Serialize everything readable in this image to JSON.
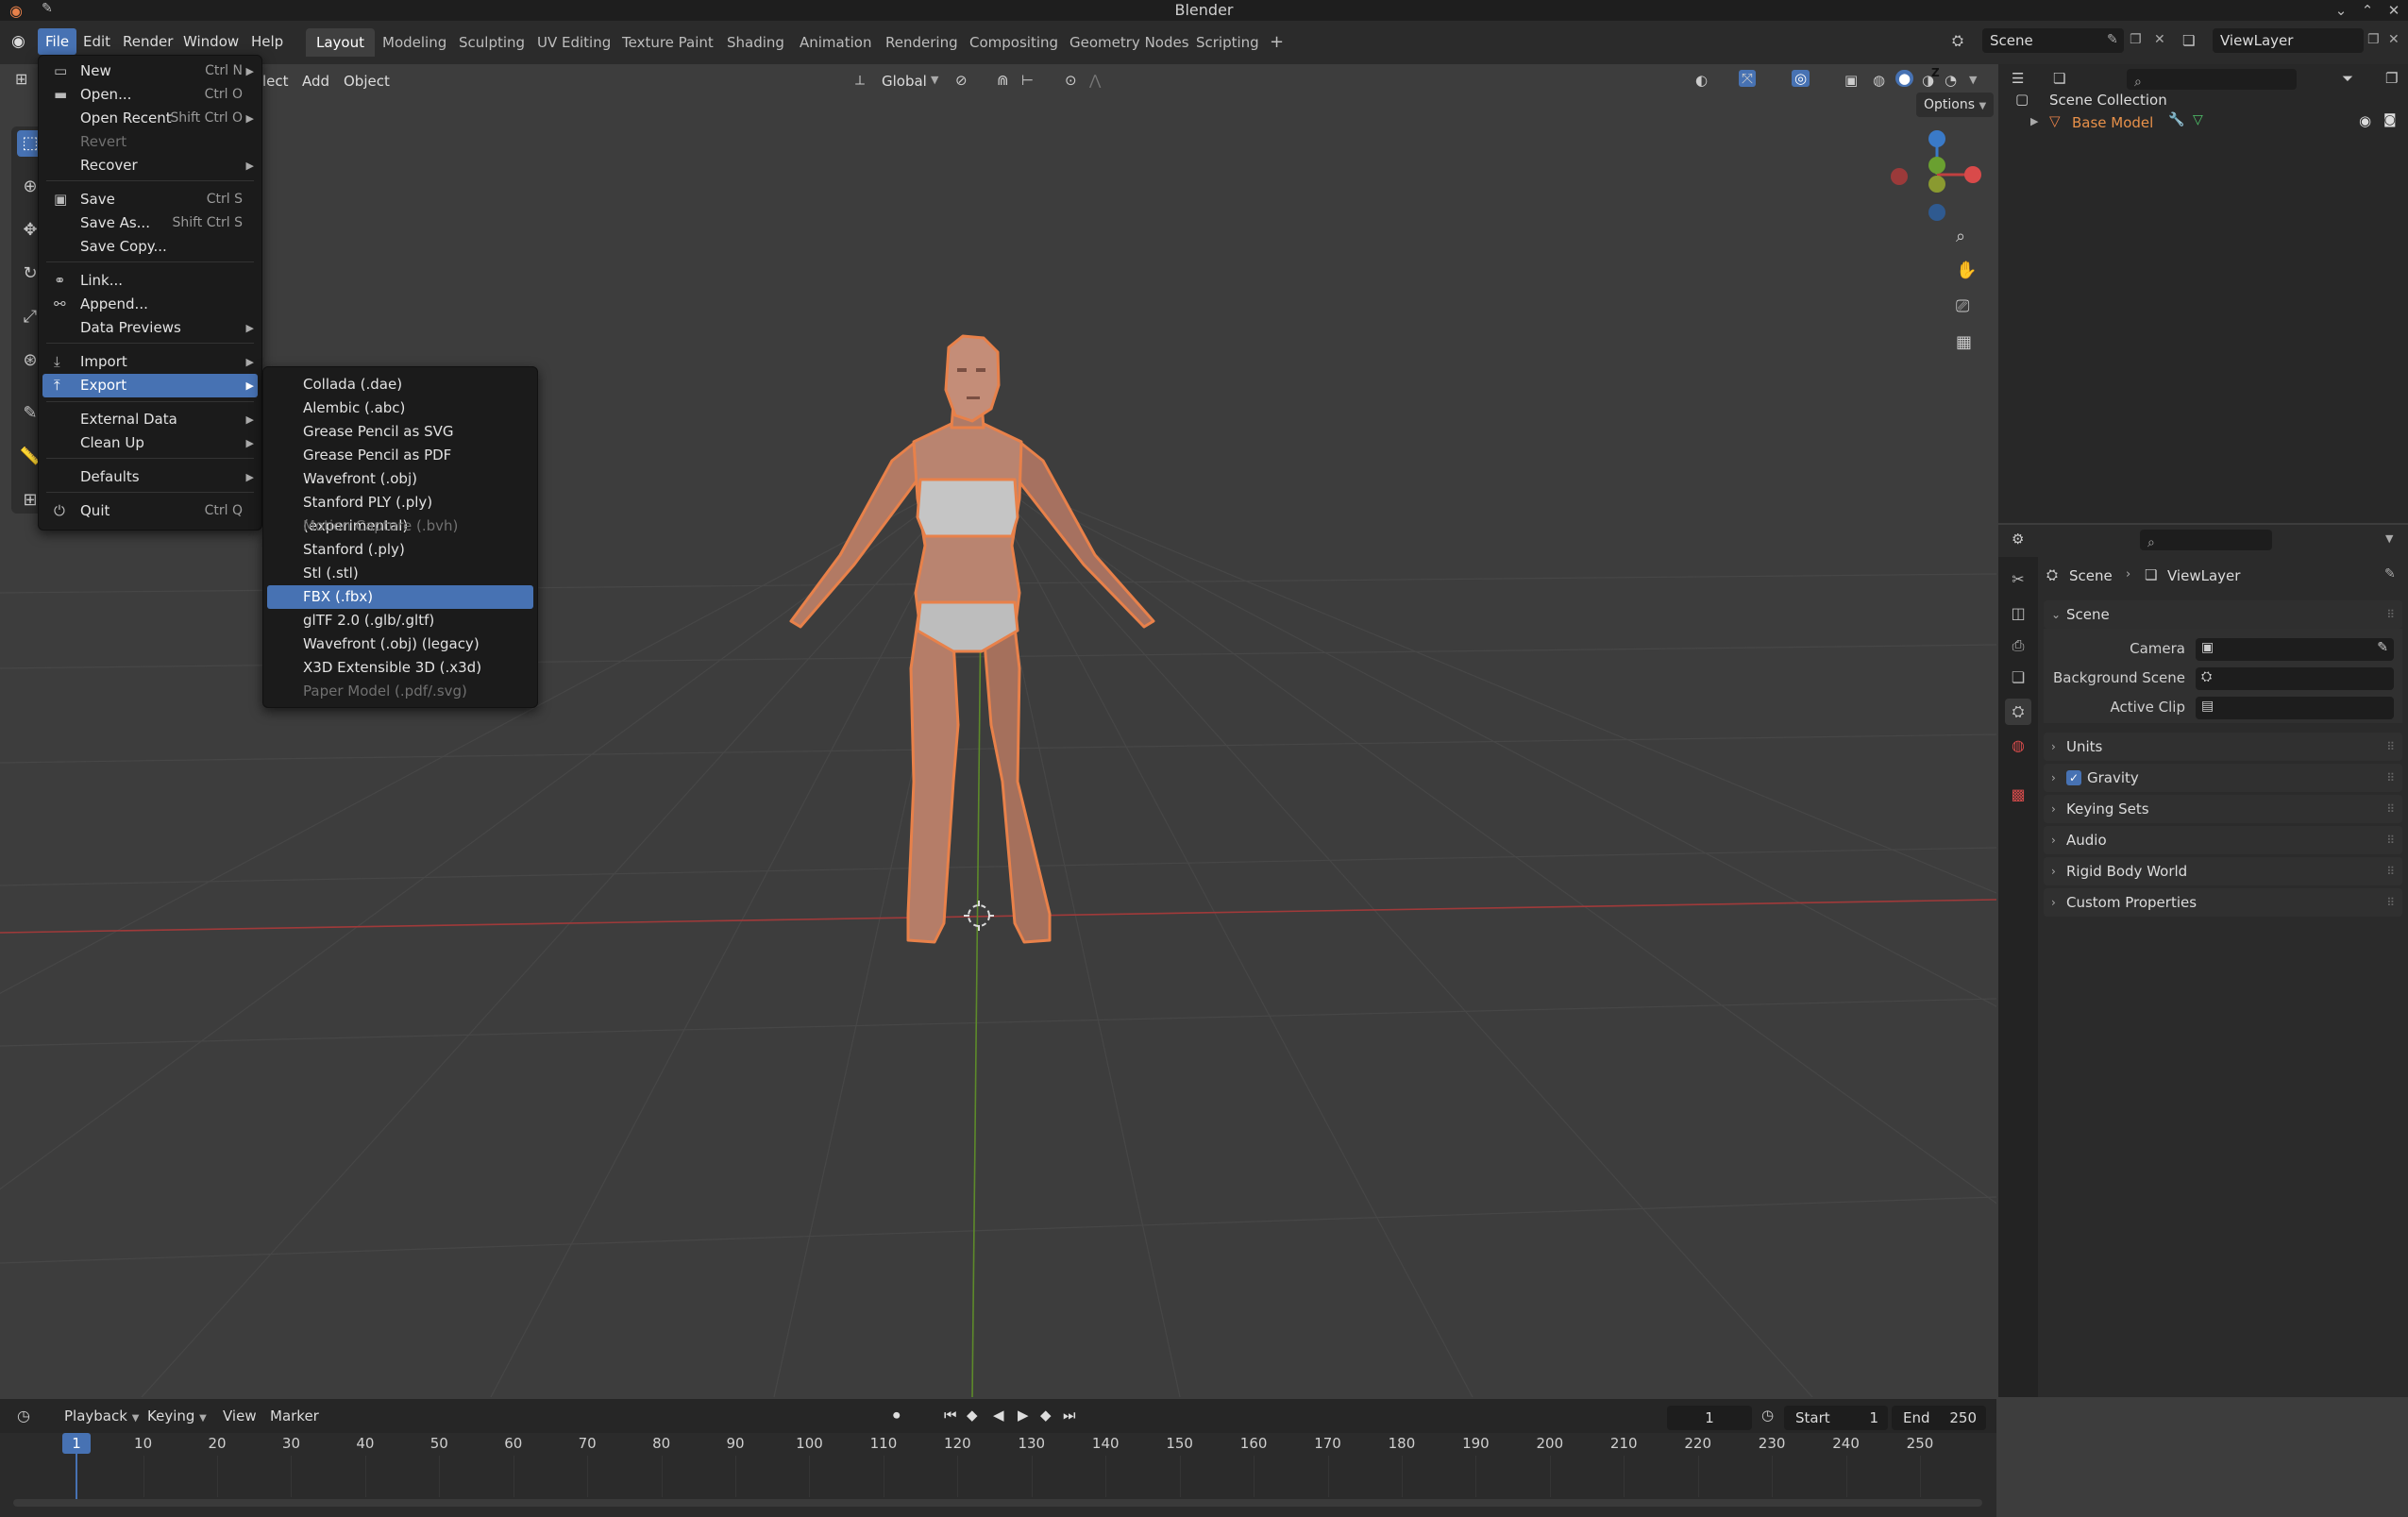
{
  "window": {
    "title": "Blender"
  },
  "menubar": {
    "items": [
      "File",
      "Edit",
      "Render",
      "Window",
      "Help"
    ],
    "active": "File"
  },
  "workspaces": {
    "tabs": [
      "Layout",
      "Modeling",
      "Sculpting",
      "UV Editing",
      "Texture Paint",
      "Shading",
      "Animation",
      "Rendering",
      "Compositing",
      "Geometry Nodes",
      "Scripting"
    ],
    "active": "Layout",
    "add": "+"
  },
  "scene_selector": {
    "value": "Scene"
  },
  "viewlayer_selector": {
    "value": "ViewLayer"
  },
  "viewport_header": {
    "select_partial": "lect",
    "add": "Add",
    "object": "Object",
    "transform_orientation": "Global",
    "options": "Options"
  },
  "gizmo": {
    "z": "Z",
    "y": "Y",
    "x": "X"
  },
  "file_menu": {
    "items": [
      {
        "label": "New",
        "shortcut": "Ctrl N",
        "icon": "new-file-icon",
        "submenu": true
      },
      {
        "label": "Open...",
        "shortcut": "Ctrl O",
        "icon": "folder-icon"
      },
      {
        "label": "Open Recent",
        "shortcut": "Shift Ctrl O",
        "submenu": true
      },
      {
        "label": "Revert",
        "disabled": true
      },
      {
        "label": "Recover",
        "submenu": true
      },
      {
        "label": "Save",
        "shortcut": "Ctrl S",
        "icon": "save-icon"
      },
      {
        "label": "Save As...",
        "shortcut": "Shift Ctrl S"
      },
      {
        "label": "Save Copy..."
      },
      {
        "label": "Link...",
        "icon": "link-icon"
      },
      {
        "label": "Append...",
        "icon": "append-icon"
      },
      {
        "label": "Data Previews",
        "submenu": true
      },
      {
        "label": "Import",
        "icon": "import-icon",
        "submenu": true
      },
      {
        "label": "Export",
        "icon": "export-icon",
        "submenu": true,
        "highlighted": true
      },
      {
        "label": "External Data",
        "submenu": true
      },
      {
        "label": "Clean Up",
        "submenu": true
      },
      {
        "label": "Defaults",
        "submenu": true
      },
      {
        "label": "Quit",
        "shortcut": "Ctrl Q",
        "icon": "power-icon"
      }
    ]
  },
  "export_menu": {
    "items": [
      {
        "label": "Collada (.dae)"
      },
      {
        "label": "Alembic (.abc)"
      },
      {
        "label": "Grease Pencil as SVG"
      },
      {
        "label": "Grease Pencil as PDF"
      },
      {
        "label": "Wavefront (.obj)"
      },
      {
        "label": "Stanford PLY (.ply) (experimental)"
      },
      {
        "label": "Motion Capture (.bvh)",
        "disabled": true
      },
      {
        "label": "Stanford (.ply)"
      },
      {
        "label": "Stl (.stl)"
      },
      {
        "label": "FBX (.fbx)",
        "highlighted": true
      },
      {
        "label": "glTF 2.0 (.glb/.gltf)"
      },
      {
        "label": "Wavefront (.obj) (legacy)"
      },
      {
        "label": "X3D Extensible 3D (.x3d)"
      },
      {
        "label": "Paper Model (.pdf/.svg)",
        "disabled": true
      }
    ]
  },
  "outliner": {
    "collection": "Scene Collection",
    "object": "Base Model"
  },
  "properties": {
    "breadcrumb_scene": "Scene",
    "breadcrumb_viewlayer": "ViewLayer",
    "scene_panel": "Scene",
    "camera_label": "Camera",
    "background_scene_label": "Background Scene",
    "active_clip_label": "Active Clip",
    "panels": [
      "Units",
      "Gravity",
      "Keying Sets",
      "Audio",
      "Rigid Body World",
      "Custom Properties"
    ],
    "gravity_checked": true
  },
  "timeline": {
    "menus": [
      "Playback",
      "Keying",
      "View",
      "Marker"
    ],
    "current_frame": "1",
    "start_label": "Start",
    "start_value": "1",
    "end_label": "End",
    "end_value": "250",
    "ticks": [
      "1",
      "10",
      "20",
      "30",
      "40",
      "50",
      "60",
      "70",
      "80",
      "90",
      "100",
      "110",
      "120",
      "130",
      "140",
      "150",
      "160",
      "170",
      "180",
      "190",
      "200",
      "210",
      "220",
      "230",
      "240",
      "250"
    ]
  },
  "colors": {
    "accent": "#4772b3",
    "selection_outline": "#e8814a",
    "object_orange": "#e8814a",
    "x_axis": "#c04040",
    "y_axis": "#6aa030",
    "z_axis": "#3a7ac8"
  }
}
